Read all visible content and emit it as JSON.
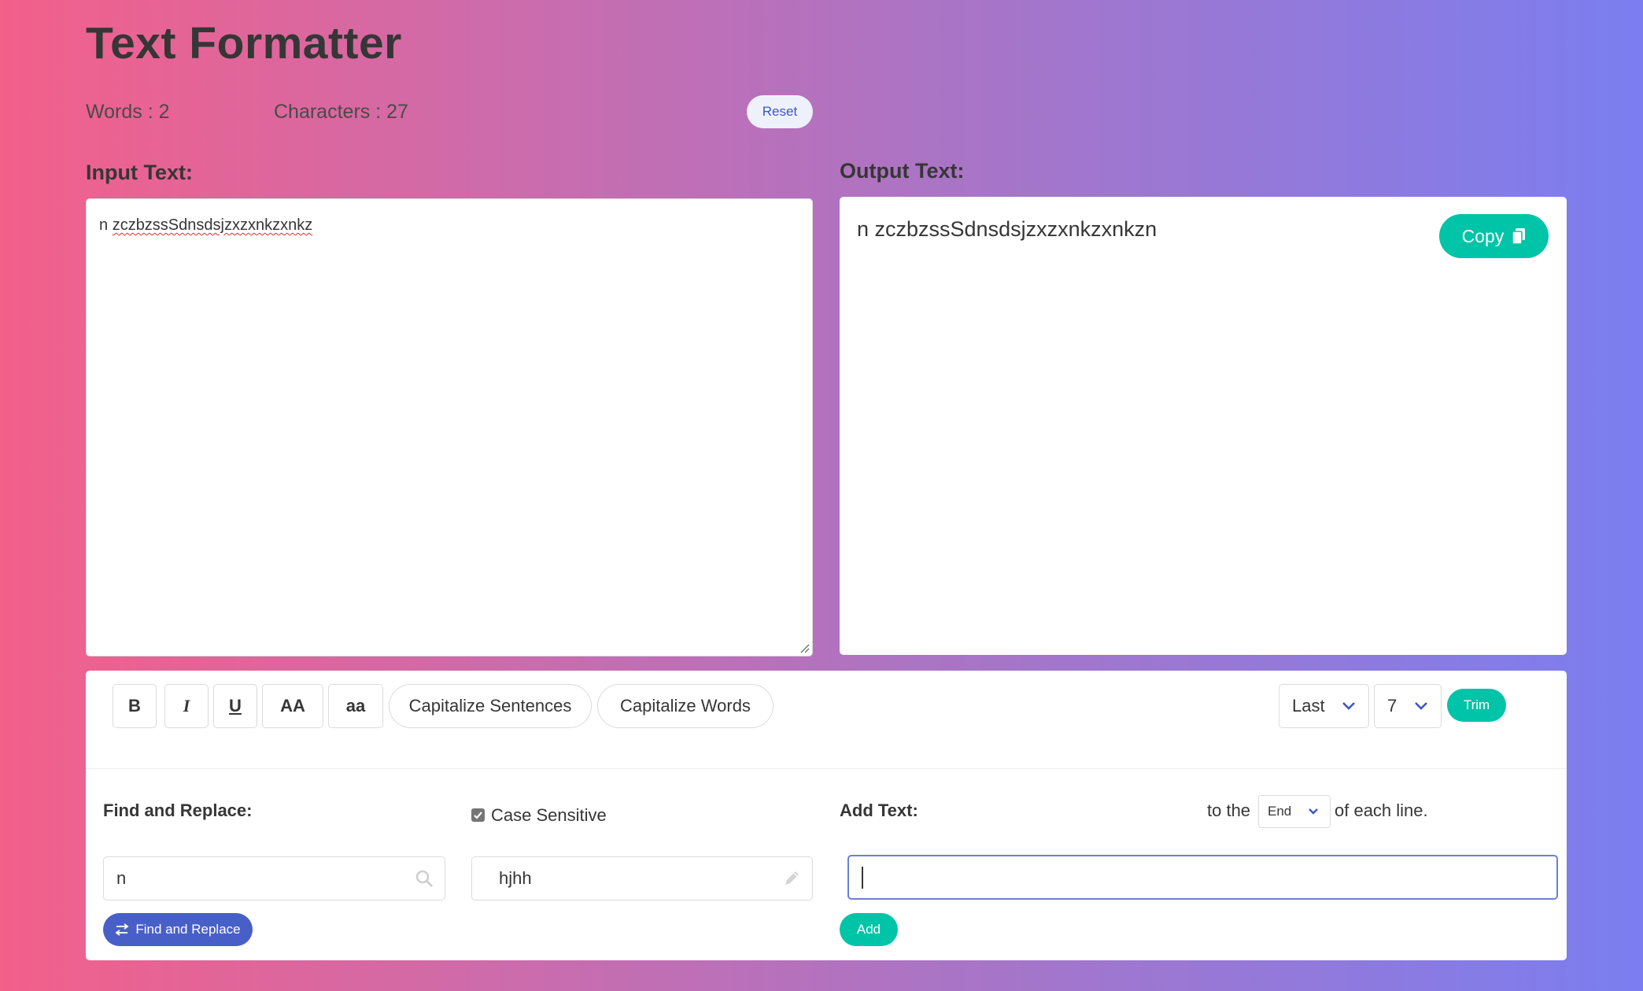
{
  "header": {
    "title": "Text Formatter",
    "words_stat": "Words : 2",
    "characters_stat": "Characters : 27",
    "reset_label": "Reset"
  },
  "input": {
    "label": "Input Text:",
    "text_first": "n ",
    "text_rest": "zczbzssSdnsdsjzxzxnkzxnkz"
  },
  "output": {
    "label": "Output Text:",
    "text": "n zczbzssSdnsdsjzxzxnkzxnkzn",
    "copy_label": "Copy"
  },
  "toolbar": {
    "bold_label": "B",
    "italic_label": "I",
    "underline_label": "U",
    "uppercase_label": "AA",
    "lowercase_label": "aa",
    "capitalize_sentences_label": "Capitalize Sentences",
    "capitalize_words_label": "Capitalize Words",
    "trim_position_value": "Last",
    "trim_count_value": "7",
    "trim_label": "Trim"
  },
  "find_replace": {
    "label": "Find and Replace:",
    "case_sensitive_label": "Case Sensitive",
    "case_sensitive_checked": true,
    "find_value": "n",
    "replace_value": "hjhh",
    "button_label": "Find and Replace"
  },
  "add_text": {
    "label": "Add Text:",
    "to_the_label": "to the",
    "position_value": "End",
    "suffix_label": "of each line.",
    "input_value": "",
    "button_label": "Add"
  },
  "colors": {
    "accent_teal": "#00c4a7",
    "accent_blue": "#485fc7",
    "text_dark": "#363636"
  }
}
